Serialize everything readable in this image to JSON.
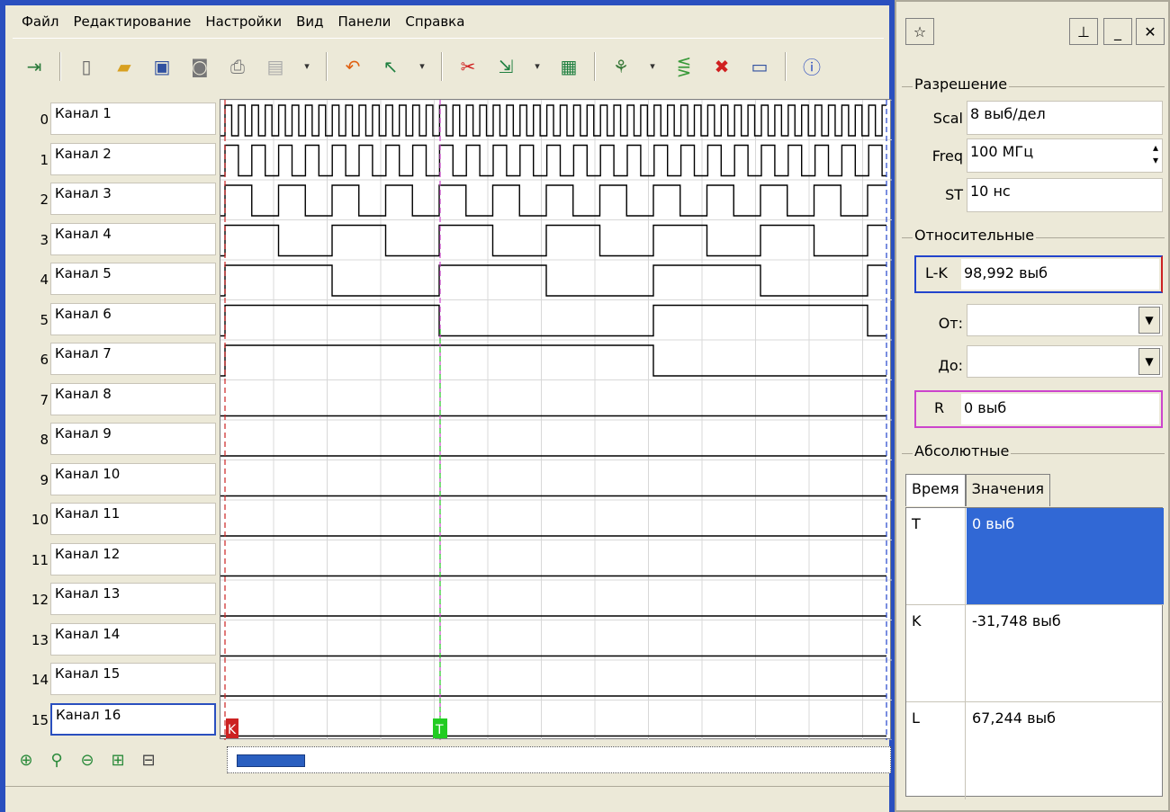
{
  "menu": [
    "Файл",
    "Редактирование",
    "Настройки",
    "Вид",
    "Панели",
    "Справка"
  ],
  "toolbar_icons": [
    "exit-icon",
    "new-icon",
    "open-icon",
    "save-icon",
    "camera-icon",
    "print-icon",
    "gray-print-icon",
    "undo-icon",
    "cursor-icon",
    "cut-icon",
    "insert-icon",
    "oscilloscope-icon",
    "wizard-icon",
    "merge-icon",
    "delete-icon",
    "panel-icon",
    "info-icon"
  ],
  "channels": [
    {
      "num": "0",
      "name": "Канал 1"
    },
    {
      "num": "1",
      "name": "Канал 2"
    },
    {
      "num": "2",
      "name": "Канал 3"
    },
    {
      "num": "3",
      "name": "Канал 4"
    },
    {
      "num": "4",
      "name": "Канал 5"
    },
    {
      "num": "5",
      "name": "Канал 6"
    },
    {
      "num": "6",
      "name": "Канал 7"
    },
    {
      "num": "7",
      "name": "Канал 8"
    },
    {
      "num": "8",
      "name": "Канал 9"
    },
    {
      "num": "9",
      "name": "Канал 10"
    },
    {
      "num": "10",
      "name": "Канал 11"
    },
    {
      "num": "11",
      "name": "Канал 12"
    },
    {
      "num": "12",
      "name": "Канал 13"
    },
    {
      "num": "13",
      "name": "Канал 14"
    },
    {
      "num": "14",
      "name": "Канал 15"
    },
    {
      "num": "15",
      "name": "Канал 16"
    }
  ],
  "selected_channel": 15,
  "markers": {
    "k_label": "K",
    "t_label": "T"
  },
  "resolution": {
    "title": "Разрешение",
    "scal_label": "Scal",
    "scal_value": "8 выб/дел",
    "freq_label": "Freq",
    "freq_value": "100 МГц",
    "st_label": "ST",
    "st_value": "10 нс"
  },
  "relative": {
    "title": "Относительные",
    "lk_label": "L-K",
    "lk_value": "98,992 выб",
    "from_label": "От:",
    "to_label": "До:",
    "r_label": "R",
    "r_value": "0 выб"
  },
  "absolute": {
    "title": "Абсолютные",
    "tabs": [
      "Время",
      "Значения"
    ],
    "rows": [
      {
        "key": "T",
        "value": "0 выб"
      },
      {
        "key": "K",
        "value": "-31,748 выб"
      },
      {
        "key": "L",
        "value": "67,244 выб"
      }
    ]
  },
  "colors": {
    "accent": "#2a4fbf",
    "k_marker": "#cc2222",
    "t_marker": "#22cc22",
    "l_marker": "#2244cc",
    "selection": "#3168d5"
  }
}
